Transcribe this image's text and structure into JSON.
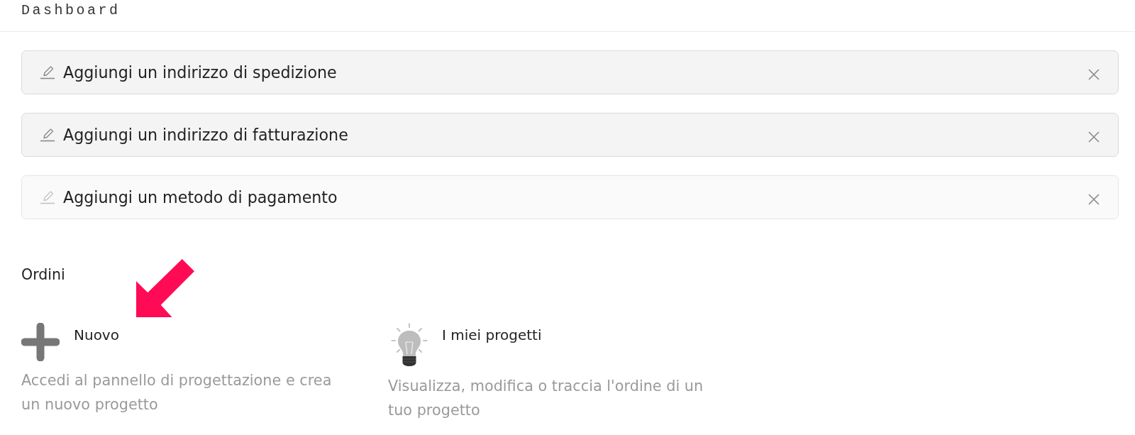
{
  "header": {
    "title": "Dashboard"
  },
  "notices": [
    {
      "text": "Aggiungi un indirizzo di spedizione",
      "highlighted": true
    },
    {
      "text": "Aggiungi un indirizzo di fatturazione",
      "highlighted": true
    },
    {
      "text": "Aggiungi un metodo di pagamento",
      "highlighted": false
    }
  ],
  "orders": {
    "title": "Ordini",
    "cards": [
      {
        "kind": "new",
        "title": "Nuovo",
        "description": "Accedi al pannello di progettazione e crea un nuovo progetto"
      },
      {
        "kind": "projects",
        "title": "I miei progetti",
        "description": "Visualizza, modifica o traccia l'ordine di un tuo progetto"
      }
    ]
  }
}
